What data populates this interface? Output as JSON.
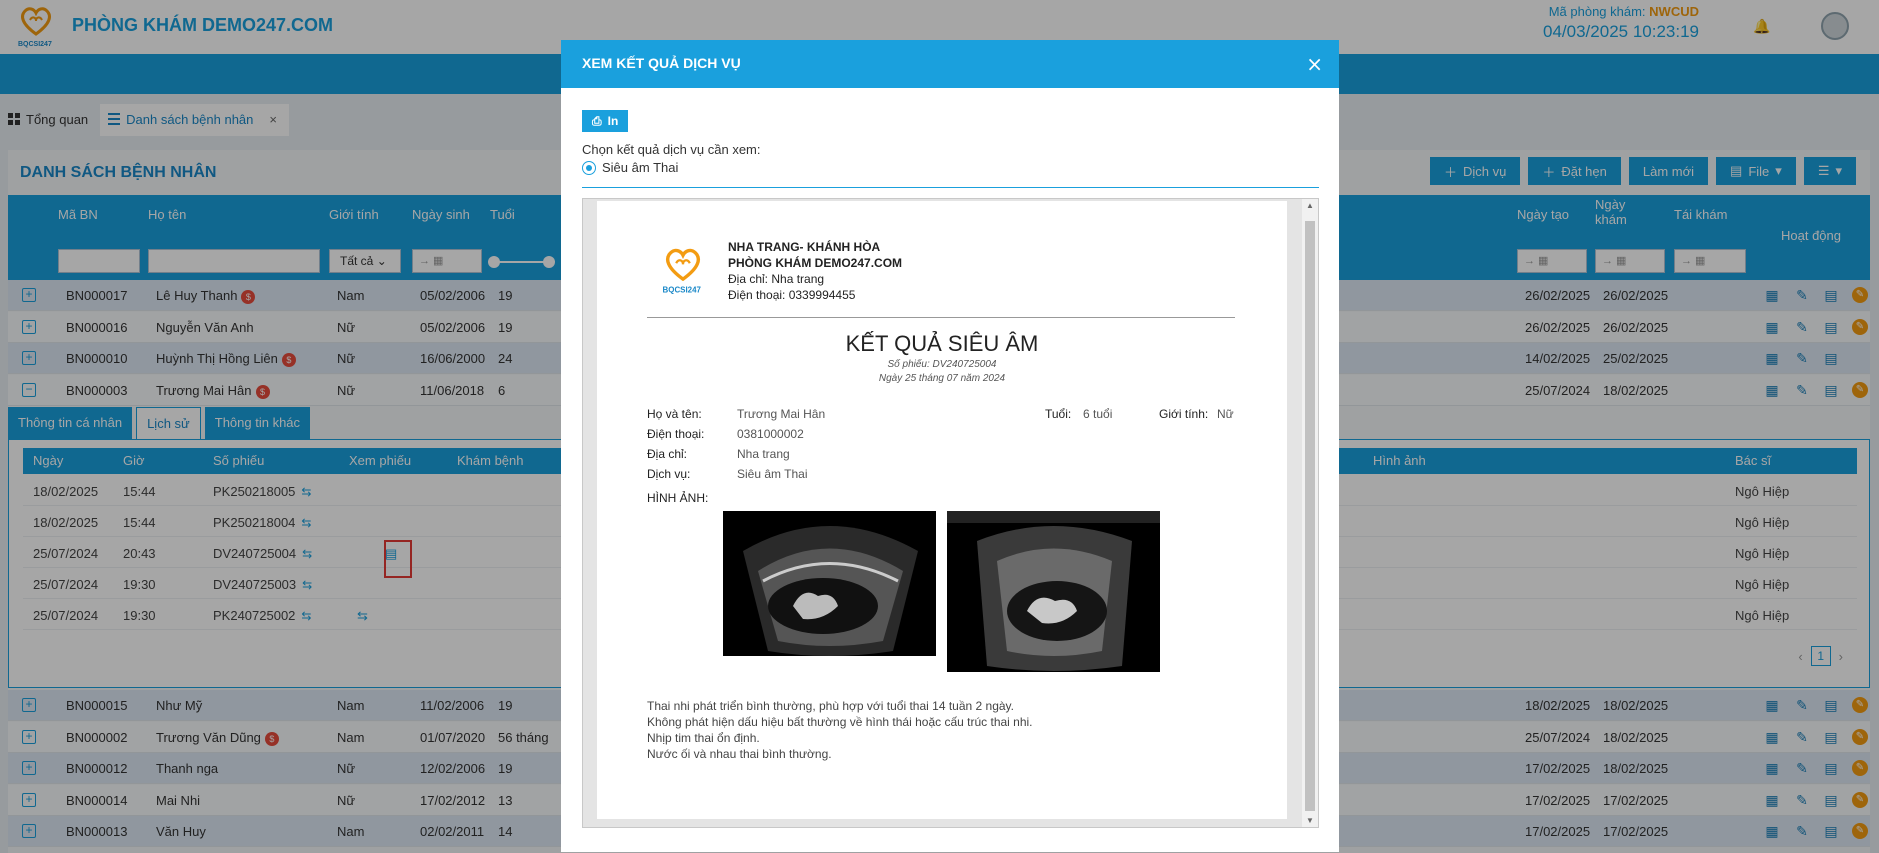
{
  "header": {
    "clinic_name": "PHÒNG KHÁM DEMO247.COM",
    "clinic_code_label": "Mã phòng khám:",
    "clinic_code": "NWCUD",
    "datetime": "04/03/2025 10:23:19",
    "logo_text": "BQCSI247"
  },
  "tabs": [
    {
      "label": "Tổng quan"
    },
    {
      "label": "Danh sách bệnh nhân",
      "close": "×"
    }
  ],
  "panel": {
    "title": "DANH SÁCH BỆNH NHÂN",
    "actions": [
      "Dịch vụ",
      "Đặt hẹn",
      "Làm mới",
      "File"
    ]
  },
  "table": {
    "headers": {
      "code": "Mã BN",
      "name": "Họ tên",
      "gender": "Giới tính",
      "dob": "Ngày sinh",
      "age": "Tuổi",
      "created": "Ngày tạo",
      "visit_1": "Ngày",
      "visit_2": "khám",
      "revisit": "Tái khám",
      "actions": "Hoạt động"
    },
    "gender_filter": "Tất cả",
    "rows_top": [
      {
        "code": "BN000017",
        "name": "Lê Huy Thanh",
        "money": true,
        "gender": "Nam",
        "dob": "05/02/2006",
        "age": "19",
        "created": "26/02/2025",
        "visit": "26/02/2025",
        "edit": true
      },
      {
        "code": "BN000016",
        "name": "Nguyễn Văn Anh",
        "money": false,
        "gender": "Nữ",
        "dob": "05/02/2006",
        "age": "19",
        "created": "26/02/2025",
        "visit": "26/02/2025",
        "edit": true
      },
      {
        "code": "BN000010",
        "name": "Huỳnh Thị Hồng Liên",
        "money": true,
        "gender": "Nữ",
        "dob": "16/06/2000",
        "age": "24",
        "created": "14/02/2025",
        "visit": "25/02/2025",
        "edit": false
      },
      {
        "code": "BN000003",
        "name": "Trương Mai Hân",
        "money": true,
        "gender": "Nữ",
        "dob": "11/06/2018",
        "age": "6",
        "created": "25/07/2024",
        "visit": "18/02/2025",
        "edit": true
      }
    ],
    "rows_bottom": [
      {
        "code": "BN000015",
        "name": "Như Mỹ",
        "money": false,
        "gender": "Nam",
        "dob": "11/02/2006",
        "age": "19",
        "created": "18/02/2025",
        "visit": "18/02/2025",
        "edit": true
      },
      {
        "code": "BN000002",
        "name": "Trương Văn Dũng",
        "money": true,
        "gender": "Nam",
        "dob": "01/07/2020",
        "age": "56 tháng",
        "created": "25/07/2024",
        "visit": "18/02/2025",
        "edit": true
      },
      {
        "code": "BN000012",
        "name": "Thanh nga",
        "money": false,
        "gender": "Nữ",
        "dob": "12/02/2006",
        "age": "19",
        "created": "17/02/2025",
        "visit": "18/02/2025",
        "edit": true
      },
      {
        "code": "BN000014",
        "name": "Mai Nhi",
        "money": false,
        "gender": "Nữ",
        "dob": "17/02/2012",
        "age": "13",
        "created": "17/02/2025",
        "visit": "17/02/2025",
        "edit": true
      },
      {
        "code": "BN000013",
        "name": "Văn Huy",
        "money": false,
        "gender": "Nam",
        "dob": "02/02/2011",
        "age": "14",
        "created": "17/02/2025",
        "visit": "17/02/2025",
        "edit": true
      }
    ]
  },
  "subtabs": [
    "Thông tin cá nhân",
    "Lịch sử",
    "Thông tin khác"
  ],
  "history": {
    "headers": {
      "date": "Ngày",
      "time": "Giờ",
      "ticket": "Số phiếu",
      "view": "Xem phiếu",
      "exam": "Khám bệnh",
      "images": "Hình ảnh",
      "doctor": "Bác sĩ"
    },
    "rows": [
      {
        "date": "18/02/2025",
        "time": "15:44",
        "ticket": "PK250218005",
        "doctor": "Ngô Hiệp"
      },
      {
        "date": "18/02/2025",
        "time": "15:44",
        "ticket": "PK250218004",
        "doctor": "Ngô Hiệp"
      },
      {
        "date": "25/07/2024",
        "time": "20:43",
        "ticket": "DV240725004",
        "doctor": "Ngô Hiệp"
      },
      {
        "date": "25/07/2024",
        "time": "19:30",
        "ticket": "DV240725003",
        "doctor": "Ngô Hiệp"
      },
      {
        "date": "25/07/2024",
        "time": "19:30",
        "ticket": "PK240725002",
        "doctor": "Ngô Hiệp"
      }
    ],
    "page": "1"
  },
  "modal": {
    "title": "XEM KẾT QUẢ DỊCH VỤ",
    "print_label": "In",
    "choose_label": "Chọn kết quả dịch vụ cần xem:",
    "option": "Siêu âm Thai",
    "doc": {
      "org_line1": "NHA TRANG- KHÁNH HÒA",
      "org_line2": "PHÒNG KHÁM DEMO247.COM",
      "org_address": "Địa chỉ: Nha trang",
      "org_phone": "Điện thoại: 0339994455",
      "title": "KẾT QUẢ SIÊU ÂM",
      "ticket": "Số phiếu: DV240725004",
      "date": "Ngày 25 tháng 07 năm 2024",
      "name_label": "Họ và tên:",
      "name": "Trương Mai Hân",
      "age_label": "Tuổi:",
      "age": "6 tuổi",
      "gender_label": "Giới tính:",
      "gender": "Nữ",
      "phone_label": "Điện thoại:",
      "phone": "0381000002",
      "address_label": "Địa chỉ:",
      "address": "Nha trang",
      "service_label": "Dịch vụ:",
      "service": "Siêu âm Thai",
      "images_label": "HÌNH ẢNH:",
      "conclusion": [
        "Thai nhi phát triển bình thường, phù hợp với tuổi thai 14 tuần 2 ngày.",
        "Không phát hiện dấu hiệu bất thường về hình thái hoặc cấu trúc thai nhi.",
        "Nhịp tim thai ổn định.",
        "Nước ối và nhau thai bình thường."
      ]
    }
  }
}
